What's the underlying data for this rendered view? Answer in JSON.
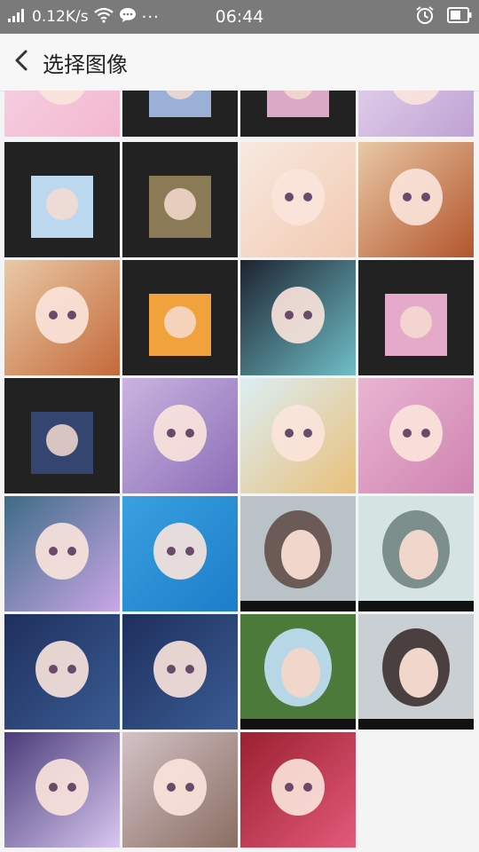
{
  "status_bar": {
    "network_speed": "0.12K/s",
    "time": "06:44",
    "notification_dots": "···"
  },
  "app_bar": {
    "title": "选择图像"
  },
  "gallery": {
    "count": 27,
    "item_label": "image-thumbnail"
  },
  "colors": {
    "status_bar_bg": "#7a7a7a",
    "app_bar_bg": "#f7f7f7",
    "grid_bg": "#f4f4f4",
    "tile_dark_frame": "#222222"
  },
  "icons": [
    "signal-icon",
    "wifi-icon",
    "message-icon",
    "alarm-icon",
    "battery-icon",
    "back-arrow-icon"
  ]
}
